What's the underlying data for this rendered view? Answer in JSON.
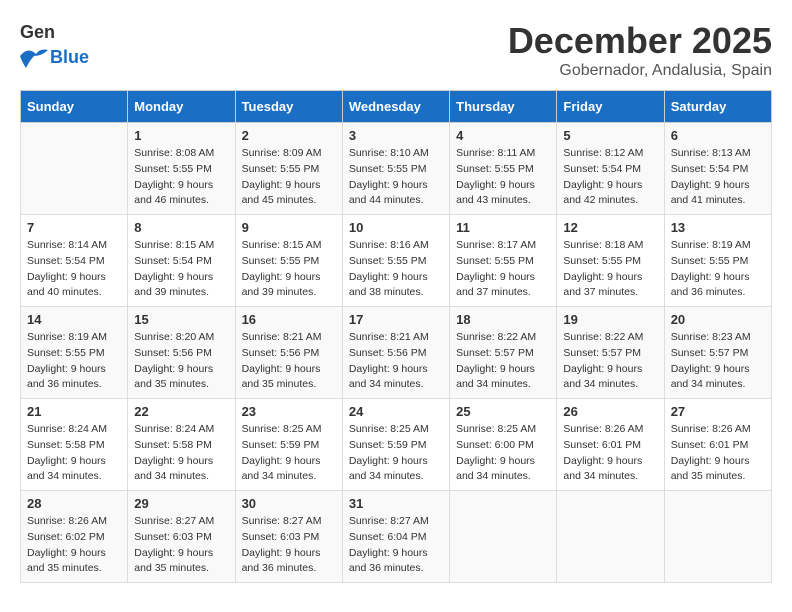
{
  "header": {
    "logo_general": "General",
    "logo_blue": "Blue",
    "month_title": "December 2025",
    "location": "Gobernador, Andalusia, Spain"
  },
  "weekdays": [
    "Sunday",
    "Monday",
    "Tuesday",
    "Wednesday",
    "Thursday",
    "Friday",
    "Saturday"
  ],
  "weeks": [
    [
      {
        "day": "",
        "sunrise": "",
        "sunset": "",
        "daylight": ""
      },
      {
        "day": "1",
        "sunrise": "Sunrise: 8:08 AM",
        "sunset": "Sunset: 5:55 PM",
        "daylight": "Daylight: 9 hours and 46 minutes."
      },
      {
        "day": "2",
        "sunrise": "Sunrise: 8:09 AM",
        "sunset": "Sunset: 5:55 PM",
        "daylight": "Daylight: 9 hours and 45 minutes."
      },
      {
        "day": "3",
        "sunrise": "Sunrise: 8:10 AM",
        "sunset": "Sunset: 5:55 PM",
        "daylight": "Daylight: 9 hours and 44 minutes."
      },
      {
        "day": "4",
        "sunrise": "Sunrise: 8:11 AM",
        "sunset": "Sunset: 5:55 PM",
        "daylight": "Daylight: 9 hours and 43 minutes."
      },
      {
        "day": "5",
        "sunrise": "Sunrise: 8:12 AM",
        "sunset": "Sunset: 5:54 PM",
        "daylight": "Daylight: 9 hours and 42 minutes."
      },
      {
        "day": "6",
        "sunrise": "Sunrise: 8:13 AM",
        "sunset": "Sunset: 5:54 PM",
        "daylight": "Daylight: 9 hours and 41 minutes."
      }
    ],
    [
      {
        "day": "7",
        "sunrise": "Sunrise: 8:14 AM",
        "sunset": "Sunset: 5:54 PM",
        "daylight": "Daylight: 9 hours and 40 minutes."
      },
      {
        "day": "8",
        "sunrise": "Sunrise: 8:15 AM",
        "sunset": "Sunset: 5:54 PM",
        "daylight": "Daylight: 9 hours and 39 minutes."
      },
      {
        "day": "9",
        "sunrise": "Sunrise: 8:15 AM",
        "sunset": "Sunset: 5:55 PM",
        "daylight": "Daylight: 9 hours and 39 minutes."
      },
      {
        "day": "10",
        "sunrise": "Sunrise: 8:16 AM",
        "sunset": "Sunset: 5:55 PM",
        "daylight": "Daylight: 9 hours and 38 minutes."
      },
      {
        "day": "11",
        "sunrise": "Sunrise: 8:17 AM",
        "sunset": "Sunset: 5:55 PM",
        "daylight": "Daylight: 9 hours and 37 minutes."
      },
      {
        "day": "12",
        "sunrise": "Sunrise: 8:18 AM",
        "sunset": "Sunset: 5:55 PM",
        "daylight": "Daylight: 9 hours and 37 minutes."
      },
      {
        "day": "13",
        "sunrise": "Sunrise: 8:19 AM",
        "sunset": "Sunset: 5:55 PM",
        "daylight": "Daylight: 9 hours and 36 minutes."
      }
    ],
    [
      {
        "day": "14",
        "sunrise": "Sunrise: 8:19 AM",
        "sunset": "Sunset: 5:55 PM",
        "daylight": "Daylight: 9 hours and 36 minutes."
      },
      {
        "day": "15",
        "sunrise": "Sunrise: 8:20 AM",
        "sunset": "Sunset: 5:56 PM",
        "daylight": "Daylight: 9 hours and 35 minutes."
      },
      {
        "day": "16",
        "sunrise": "Sunrise: 8:21 AM",
        "sunset": "Sunset: 5:56 PM",
        "daylight": "Daylight: 9 hours and 35 minutes."
      },
      {
        "day": "17",
        "sunrise": "Sunrise: 8:21 AM",
        "sunset": "Sunset: 5:56 PM",
        "daylight": "Daylight: 9 hours and 34 minutes."
      },
      {
        "day": "18",
        "sunrise": "Sunrise: 8:22 AM",
        "sunset": "Sunset: 5:57 PM",
        "daylight": "Daylight: 9 hours and 34 minutes."
      },
      {
        "day": "19",
        "sunrise": "Sunrise: 8:22 AM",
        "sunset": "Sunset: 5:57 PM",
        "daylight": "Daylight: 9 hours and 34 minutes."
      },
      {
        "day": "20",
        "sunrise": "Sunrise: 8:23 AM",
        "sunset": "Sunset: 5:57 PM",
        "daylight": "Daylight: 9 hours and 34 minutes."
      }
    ],
    [
      {
        "day": "21",
        "sunrise": "Sunrise: 8:24 AM",
        "sunset": "Sunset: 5:58 PM",
        "daylight": "Daylight: 9 hours and 34 minutes."
      },
      {
        "day": "22",
        "sunrise": "Sunrise: 8:24 AM",
        "sunset": "Sunset: 5:58 PM",
        "daylight": "Daylight: 9 hours and 34 minutes."
      },
      {
        "day": "23",
        "sunrise": "Sunrise: 8:25 AM",
        "sunset": "Sunset: 5:59 PM",
        "daylight": "Daylight: 9 hours and 34 minutes."
      },
      {
        "day": "24",
        "sunrise": "Sunrise: 8:25 AM",
        "sunset": "Sunset: 5:59 PM",
        "daylight": "Daylight: 9 hours and 34 minutes."
      },
      {
        "day": "25",
        "sunrise": "Sunrise: 8:25 AM",
        "sunset": "Sunset: 6:00 PM",
        "daylight": "Daylight: 9 hours and 34 minutes."
      },
      {
        "day": "26",
        "sunrise": "Sunrise: 8:26 AM",
        "sunset": "Sunset: 6:01 PM",
        "daylight": "Daylight: 9 hours and 34 minutes."
      },
      {
        "day": "27",
        "sunrise": "Sunrise: 8:26 AM",
        "sunset": "Sunset: 6:01 PM",
        "daylight": "Daylight: 9 hours and 35 minutes."
      }
    ],
    [
      {
        "day": "28",
        "sunrise": "Sunrise: 8:26 AM",
        "sunset": "Sunset: 6:02 PM",
        "daylight": "Daylight: 9 hours and 35 minutes."
      },
      {
        "day": "29",
        "sunrise": "Sunrise: 8:27 AM",
        "sunset": "Sunset: 6:03 PM",
        "daylight": "Daylight: 9 hours and 35 minutes."
      },
      {
        "day": "30",
        "sunrise": "Sunrise: 8:27 AM",
        "sunset": "Sunset: 6:03 PM",
        "daylight": "Daylight: 9 hours and 36 minutes."
      },
      {
        "day": "31",
        "sunrise": "Sunrise: 8:27 AM",
        "sunset": "Sunset: 6:04 PM",
        "daylight": "Daylight: 9 hours and 36 minutes."
      },
      {
        "day": "",
        "sunrise": "",
        "sunset": "",
        "daylight": ""
      },
      {
        "day": "",
        "sunrise": "",
        "sunset": "",
        "daylight": ""
      },
      {
        "day": "",
        "sunrise": "",
        "sunset": "",
        "daylight": ""
      }
    ]
  ]
}
